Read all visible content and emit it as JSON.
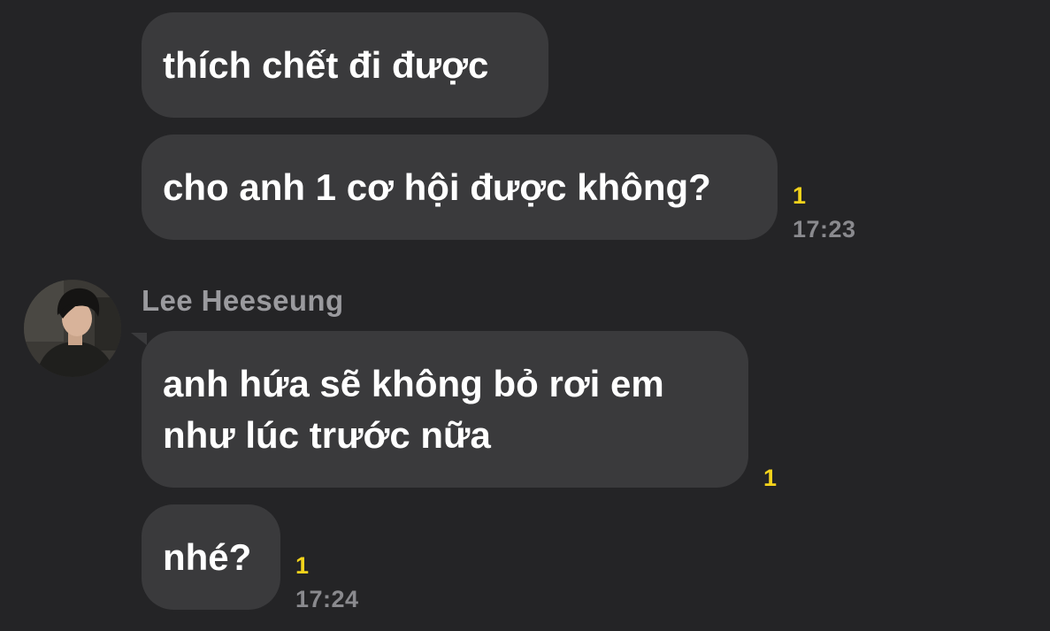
{
  "messages": [
    {
      "text": "thích chết đi được",
      "unread": "",
      "time": ""
    },
    {
      "text": "cho anh 1 cơ hội được không?",
      "unread": "1",
      "time": "17:23"
    },
    {
      "text_lines": [
        "anh hứa sẽ không bỏ rơi em",
        "như lúc trước nữa"
      ],
      "unread": "1",
      "time": ""
    },
    {
      "text": "nhé?",
      "unread": "1",
      "time": "17:24"
    }
  ],
  "sender": {
    "name": "Lee Heeseung",
    "avatar_icon": "user-avatar"
  },
  "colors": {
    "background": "#242426",
    "bubble": "#3a3a3c",
    "unread": "#f5d31b",
    "timestamp": "#8a8a8e",
    "sender_name": "#9a9a9e"
  }
}
